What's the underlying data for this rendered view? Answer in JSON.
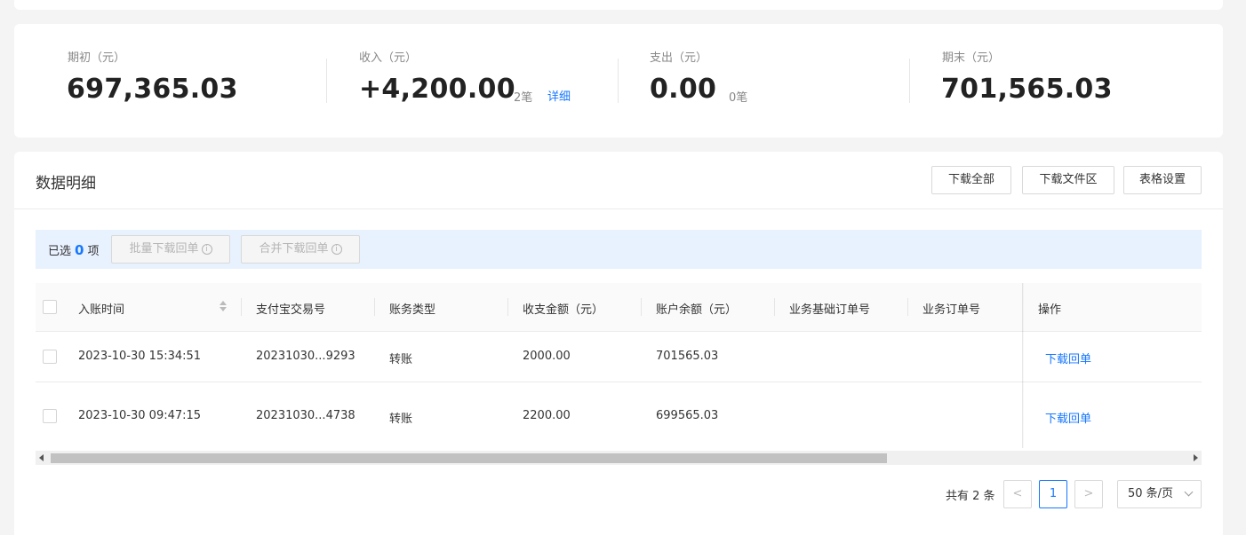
{
  "summary": {
    "opening": {
      "label": "期初（元）",
      "value": "697,365.03"
    },
    "income": {
      "label": "收入（元）",
      "value": "+4,200.00",
      "count": "2笔",
      "detail_link": "详细"
    },
    "expense": {
      "label": "支出（元）",
      "value": "0.00",
      "count": "0笔"
    },
    "closing": {
      "label": "期末（元）",
      "value": "701,565.03"
    }
  },
  "detail": {
    "title": "数据明细",
    "buttons": {
      "download_all": "下载全部",
      "download_folder": "下载文件区",
      "table_settings": "表格设置"
    },
    "selection": {
      "prefix": "已选",
      "count": "0",
      "suffix": "项",
      "batch_download": "批量下载回单",
      "merge_download": "合并下载回单",
      "info_glyph": "i"
    },
    "table": {
      "columns": [
        "入账时间",
        "支付宝交易号",
        "账务类型",
        "收支金额（元）",
        "账户余额（元）",
        "业务基础订单号",
        "业务订单号",
        "操作"
      ],
      "rows": [
        {
          "time": "2023-10-30 15:34:51",
          "trade_no": "20231030...9293",
          "type": "转账",
          "amount": "2000.00",
          "balance": "701565.03",
          "base_order": "",
          "order": "",
          "action": "下载回单"
        },
        {
          "time": "2023-10-30 09:47:15",
          "trade_no": "20231030...4738",
          "type": "转账",
          "amount": "2200.00",
          "balance": "699565.03",
          "base_order": "",
          "order": "",
          "action": "下载回单"
        }
      ]
    },
    "pagination": {
      "total_text": "共有 2 条",
      "prev": "<",
      "current_page": "1",
      "next": ">",
      "page_size": "50 条/页"
    }
  }
}
